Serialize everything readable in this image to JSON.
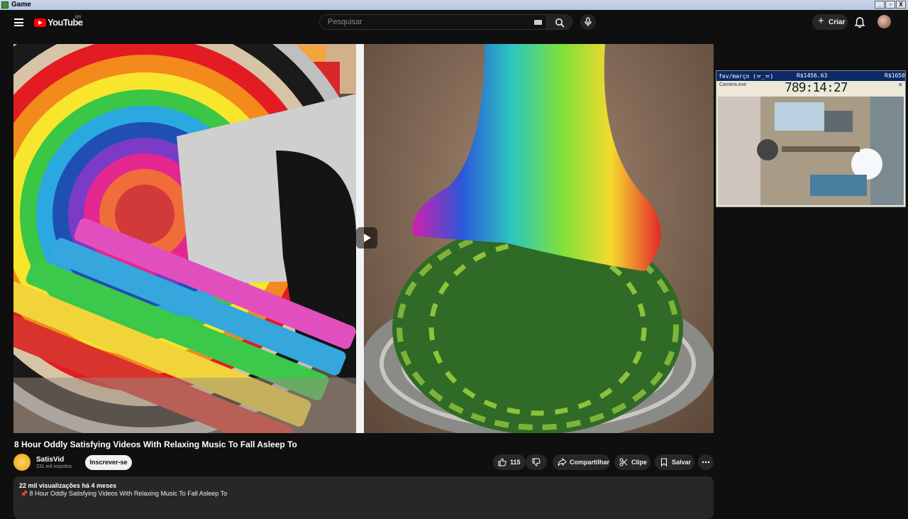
{
  "window": {
    "title": "Game",
    "controls": [
      "_",
      "▫",
      "X"
    ]
  },
  "header": {
    "logo_text": "YouTube",
    "country_code": "BR",
    "search_placeholder": "Pesquisar",
    "create_label": "Criar"
  },
  "video": {
    "title": "8 Hour Oddly Satisfying Videos With Relaxing Music To Fall Asleep To",
    "channel": "SatisVid",
    "subscribers": "231 mil inscritos",
    "subscribe_label": "Inscrever-se",
    "like_count": "115",
    "share_label": "Compartilhar",
    "clip_label": "Clipe",
    "save_label": "Salvar",
    "views_age": "22 mil visualizações  há 4 meses",
    "description_line": "8 Hour Oddly Satisfying Videos With Relaxing Music To Fall Asleep To"
  },
  "overlay": {
    "month": "fev/março (ㅠ_ㅠ)",
    "amount": "R$1456.63",
    "goal": "R$1650",
    "camera_title": "Camera.exe",
    "timer": "789:14:27"
  },
  "colors": {
    "background": "#0f0f0f",
    "brand_red": "#ff0000",
    "pill": "#272727"
  }
}
